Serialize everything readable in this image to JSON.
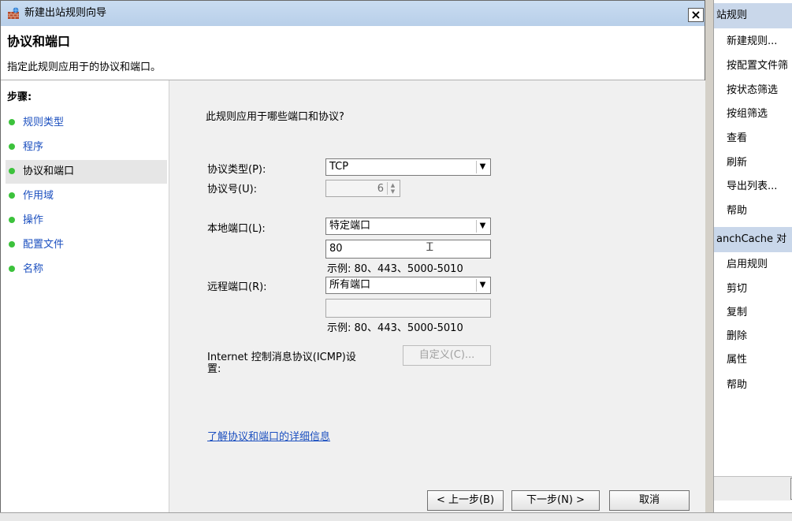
{
  "dialog": {
    "title": "新建出站规则向导",
    "close_label": "×",
    "page_title": "协议和端口",
    "page_subtitle": "指定此规则应用于的协议和端口。"
  },
  "steps": {
    "heading": "步骤:",
    "items": [
      {
        "label": "规则类型"
      },
      {
        "label": "程序"
      },
      {
        "label": "协议和端口"
      },
      {
        "label": "作用域"
      },
      {
        "label": "操作"
      },
      {
        "label": "配置文件"
      },
      {
        "label": "名称"
      }
    ],
    "active_index": 2
  },
  "form": {
    "question": "此规则应用于哪些端口和协议?",
    "protocol_type_label": "协议类型(P):",
    "protocol_type_value": "TCP",
    "protocol_number_label": "协议号(U):",
    "protocol_number_value": "6",
    "local_port_label": "本地端口(L):",
    "local_port_value": "特定端口",
    "local_port_input": "80",
    "local_port_example": "示例: 80、443、5000-5010",
    "remote_port_label": "远程端口(R):",
    "remote_port_value": "所有端口",
    "remote_port_input": "",
    "remote_port_example": "示例: 80、443、5000-5010",
    "icmp_label_line1": "Internet 控制消息协议(ICMP)设",
    "icmp_label_line2": "置:",
    "customize_label": "自定义(C)...",
    "learn_more_link": "了解协议和端口的详细信息"
  },
  "buttons": {
    "back": "< 上一步(B)",
    "next": "下一步(N) >",
    "cancel": "取消"
  },
  "actions_panel": {
    "section1_title": "站规则",
    "section1_items": [
      "新建规则...",
      "按配置文件筛",
      "按状态筛选",
      "按组筛选",
      "查看",
      "刷新",
      "导出列表...",
      "帮助"
    ],
    "section2_title": "anchCache 对",
    "section2_items": [
      "启用规则",
      "剪切",
      "复制",
      "删除",
      "属性",
      "帮助"
    ]
  }
}
